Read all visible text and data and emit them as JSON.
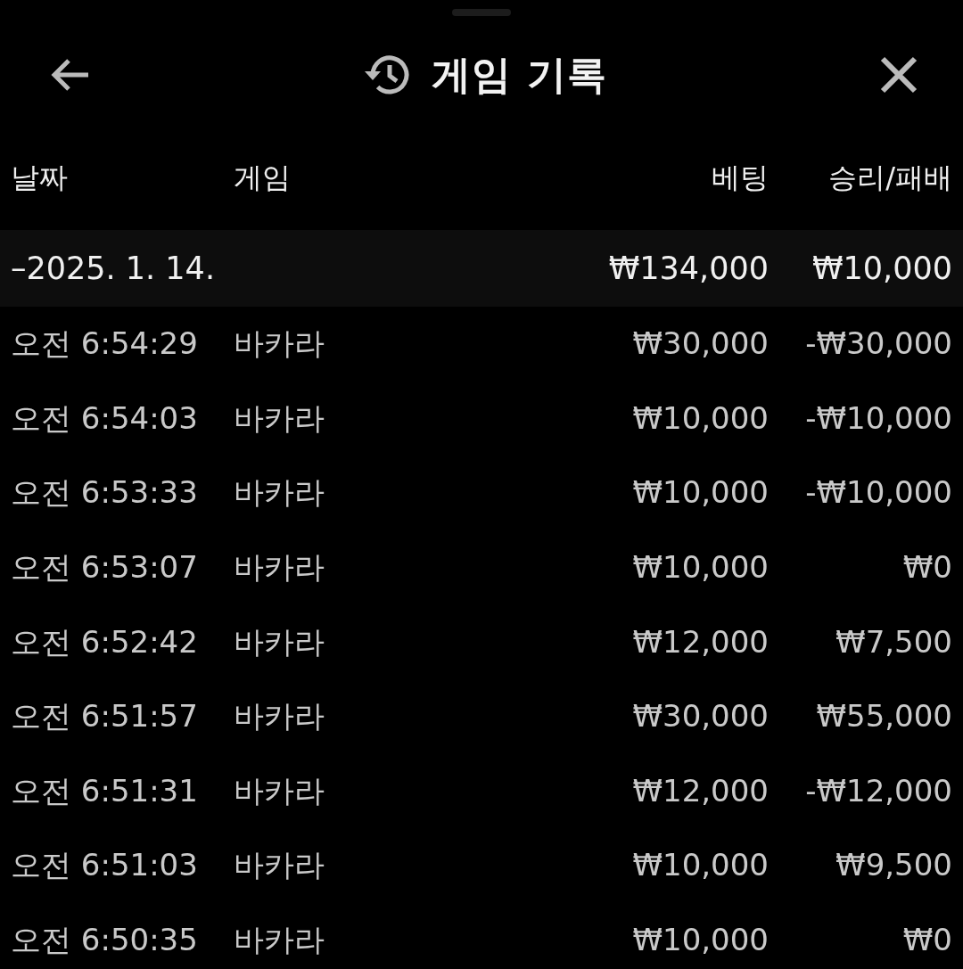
{
  "header": {
    "title": "게임 기록"
  },
  "columns": [
    "날짜",
    "게임",
    "베팅",
    "승리/패배"
  ],
  "groups": [
    {
      "date": "–2025. 1. 14.",
      "bet": "₩134,000",
      "result": "₩10,000",
      "rows": [
        {
          "time": "오전 6:54:29",
          "game": "바카라",
          "bet": "₩30,000",
          "result": "-₩30,000"
        },
        {
          "time": "오전 6:54:03",
          "game": "바카라",
          "bet": "₩10,000",
          "result": "-₩10,000"
        },
        {
          "time": "오전 6:53:33",
          "game": "바카라",
          "bet": "₩10,000",
          "result": "-₩10,000"
        },
        {
          "time": "오전 6:53:07",
          "game": "바카라",
          "bet": "₩10,000",
          "result": "₩0"
        },
        {
          "time": "오전 6:52:42",
          "game": "바카라",
          "bet": "₩12,000",
          "result": "₩7,500"
        },
        {
          "time": "오전 6:51:57",
          "game": "바카라",
          "bet": "₩30,000",
          "result": "₩55,000"
        },
        {
          "time": "오전 6:51:31",
          "game": "바카라",
          "bet": "₩12,000",
          "result": "-₩12,000"
        },
        {
          "time": "오전 6:51:03",
          "game": "바카라",
          "bet": "₩10,000",
          "result": "₩9,500"
        },
        {
          "time": "오전 6:50:35",
          "game": "바카라",
          "bet": "₩10,000",
          "result": "₩0"
        }
      ]
    }
  ]
}
